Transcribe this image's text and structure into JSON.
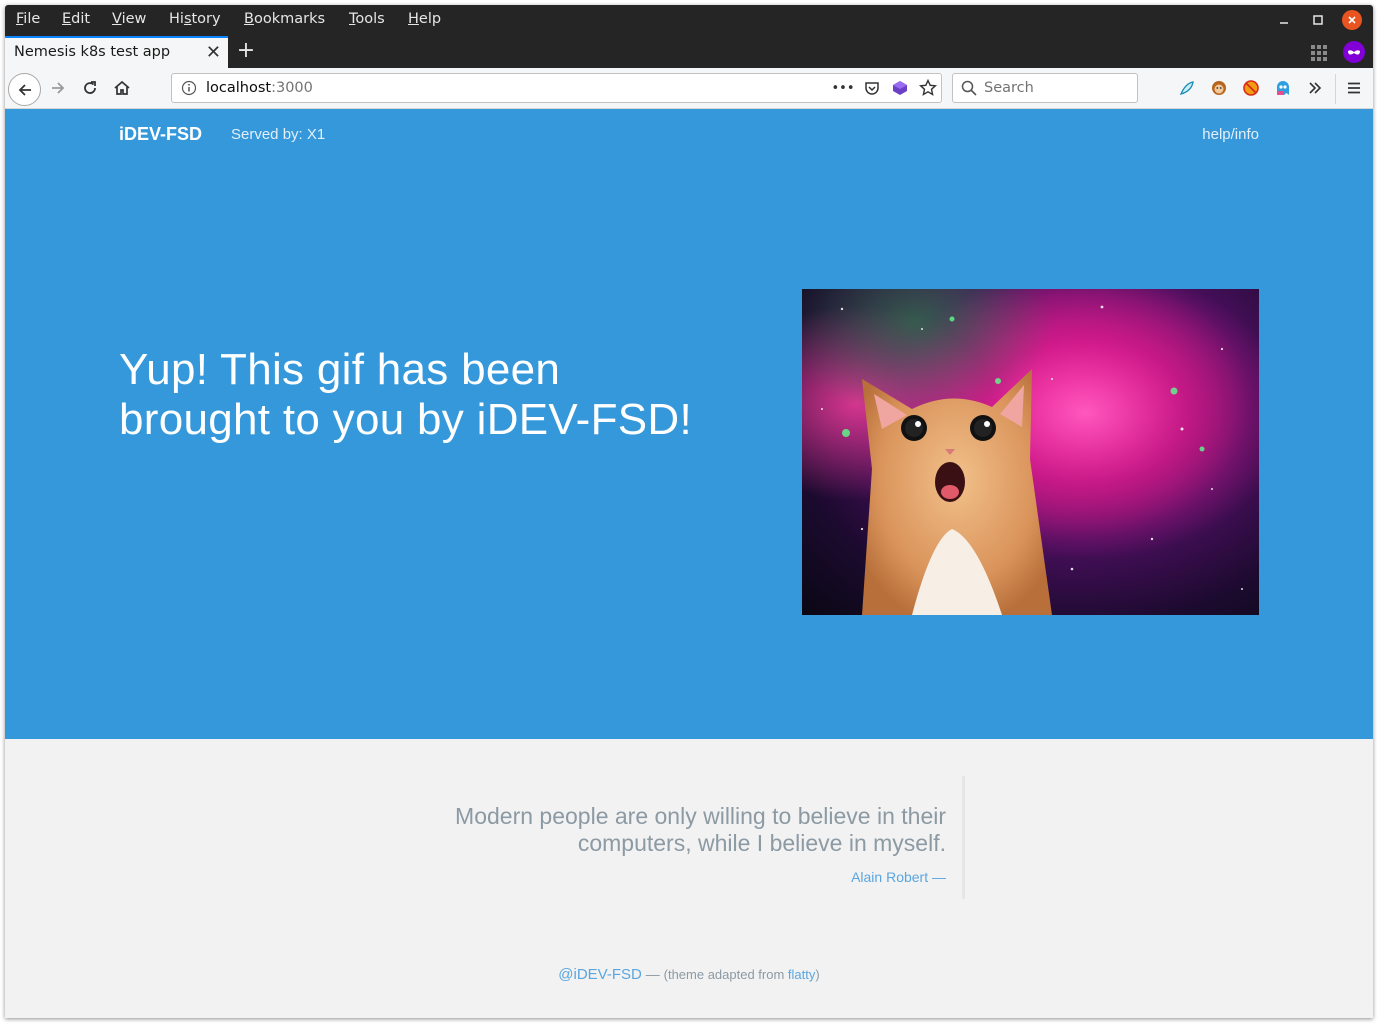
{
  "menubar": {
    "items": [
      {
        "pre": "",
        "ul": "F",
        "post": "ile"
      },
      {
        "pre": "",
        "ul": "E",
        "post": "dit"
      },
      {
        "pre": "",
        "ul": "V",
        "post": "iew"
      },
      {
        "pre": "Hi",
        "ul": "s",
        "post": "tory"
      },
      {
        "pre": "",
        "ul": "B",
        "post": "ookmarks"
      },
      {
        "pre": "",
        "ul": "T",
        "post": "ools"
      },
      {
        "pre": "",
        "ul": "H",
        "post": "elp"
      }
    ]
  },
  "tab": {
    "title": "Nemesis k8s test app",
    "close": "✕"
  },
  "newtab": "+",
  "urlbar": {
    "host": "localhost",
    "port": ":3000",
    "more": "•••"
  },
  "search": {
    "placeholder": "Search"
  },
  "hero": {
    "brand": "iDEV-FSD",
    "served": "Served by: X1",
    "help": "help/info",
    "headline_line1": "Yup! This gif has been",
    "headline_line2": "brought to you by iDEV-FSD!"
  },
  "quote": {
    "line1": "Modern people are only willing to believe in their",
    "line2": "computers, while I believe in myself.",
    "author": "Alain Robert —"
  },
  "footer": {
    "handle": "@iDEV-FSD",
    "dash": " — ",
    "theme_prefix": "(theme adapted from ",
    "theme_link": "flatty",
    "theme_suffix": ")"
  },
  "colors": {
    "hero_bg": "#3498db",
    "quote_bg": "#f2f2f2",
    "link": "#5aa6e0",
    "chrome_dark": "#252526",
    "tab_accent": "#0a84ff"
  }
}
